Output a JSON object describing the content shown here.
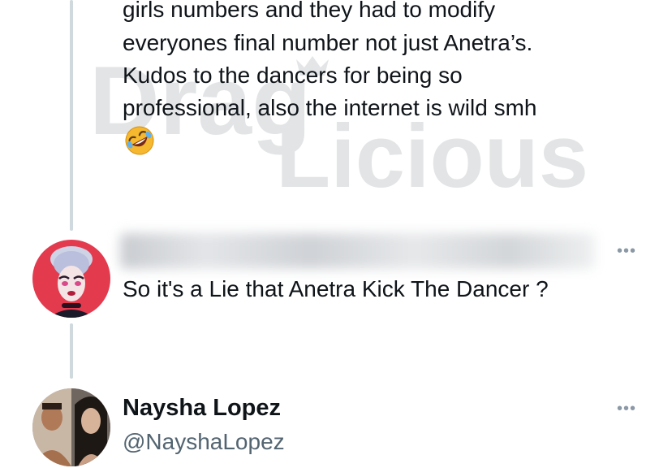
{
  "watermark": {
    "text": "DragLicious"
  },
  "tweet1": {
    "lines": [
      "girls numbers and they had to modify",
      "everyones final number not just Anetra’s.",
      "Kudos to the dancers for being so",
      "professional, also the internet is wild smh"
    ],
    "emoji": "rolling-on-floor-laughing"
  },
  "tweet2": {
    "text": "So it's a Lie that Anetra Kick The Dancer ?",
    "more": "•••"
  },
  "tweet3": {
    "display_name": "Naysha Lopez",
    "handle": "@NayshaLopez",
    "more": "•••"
  },
  "colors": {
    "thread_line": "#cfd9de",
    "text": "#0f1419",
    "secondary": "#536471"
  }
}
